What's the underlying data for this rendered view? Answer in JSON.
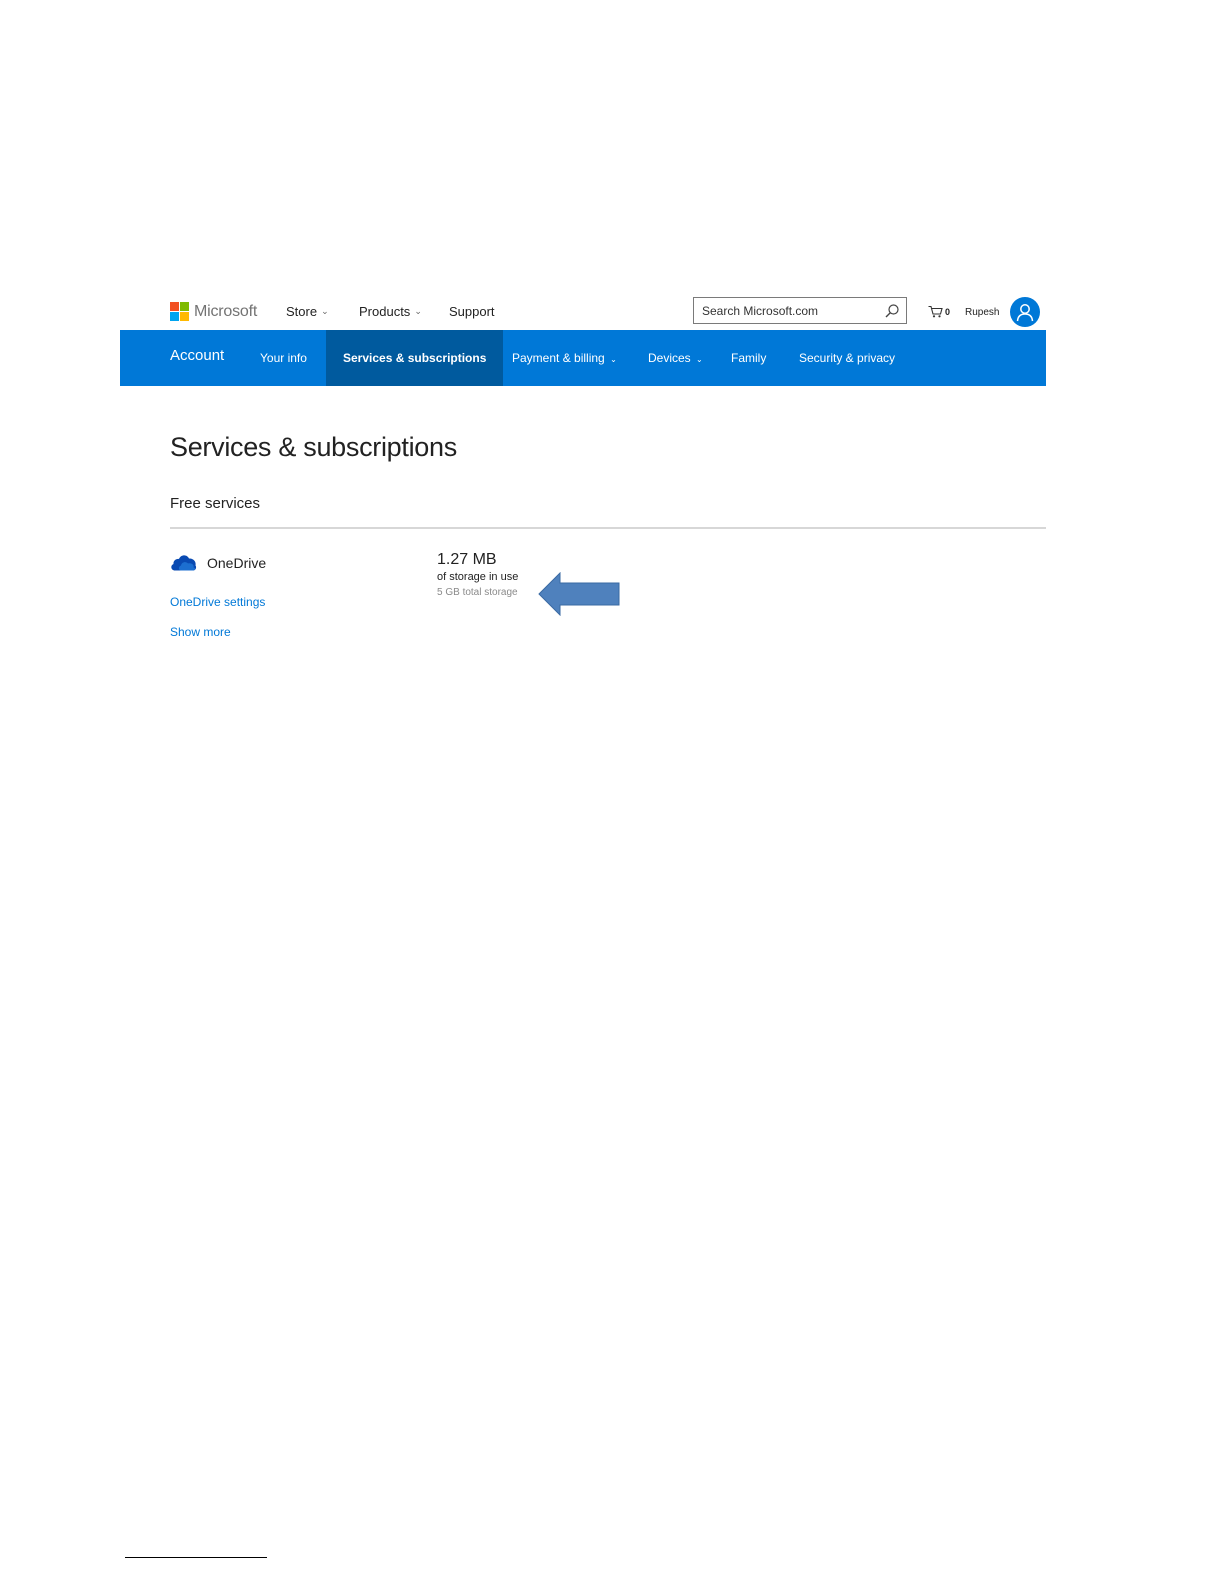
{
  "header": {
    "brand": "Microsoft",
    "logo_colors": [
      "#f25022",
      "#7fba00",
      "#00a4ef",
      "#ffb900"
    ],
    "nav": [
      {
        "label": "Store",
        "has_dropdown": true
      },
      {
        "label": "Products",
        "has_dropdown": true
      },
      {
        "label": "Support",
        "has_dropdown": false
      }
    ],
    "search": {
      "value": "",
      "placeholder": "Search Microsoft.com",
      "icon": "search-icon"
    },
    "cart": {
      "icon": "cart-icon",
      "count": "0"
    },
    "user": {
      "name": "Rupesh",
      "icon": "user-avatar-icon"
    }
  },
  "account_nav": {
    "title": "Account",
    "accent": "#0078d7",
    "active_bg": "#005a9e",
    "items": [
      {
        "label": "Your info",
        "has_dropdown": false
      },
      {
        "label": "Services & subscriptions",
        "has_dropdown": false,
        "active": true
      },
      {
        "label": "Payment & billing",
        "has_dropdown": true
      },
      {
        "label": "Devices",
        "has_dropdown": true
      },
      {
        "label": "Family",
        "has_dropdown": false
      },
      {
        "label": "Security & privacy",
        "has_dropdown": false
      }
    ]
  },
  "main": {
    "title": "Services & subscriptions",
    "section": "Free services",
    "service": {
      "icon": "onedrive-cloud-icon",
      "name": "OneDrive",
      "links": [
        "OneDrive settings",
        "Show more"
      ],
      "usage": {
        "value": "1.27 MB",
        "label": "of storage in use",
        "total": "5 GB total storage"
      },
      "annotation": {
        "icon": "left-arrow-icon",
        "color": "#4f81bd"
      }
    }
  }
}
